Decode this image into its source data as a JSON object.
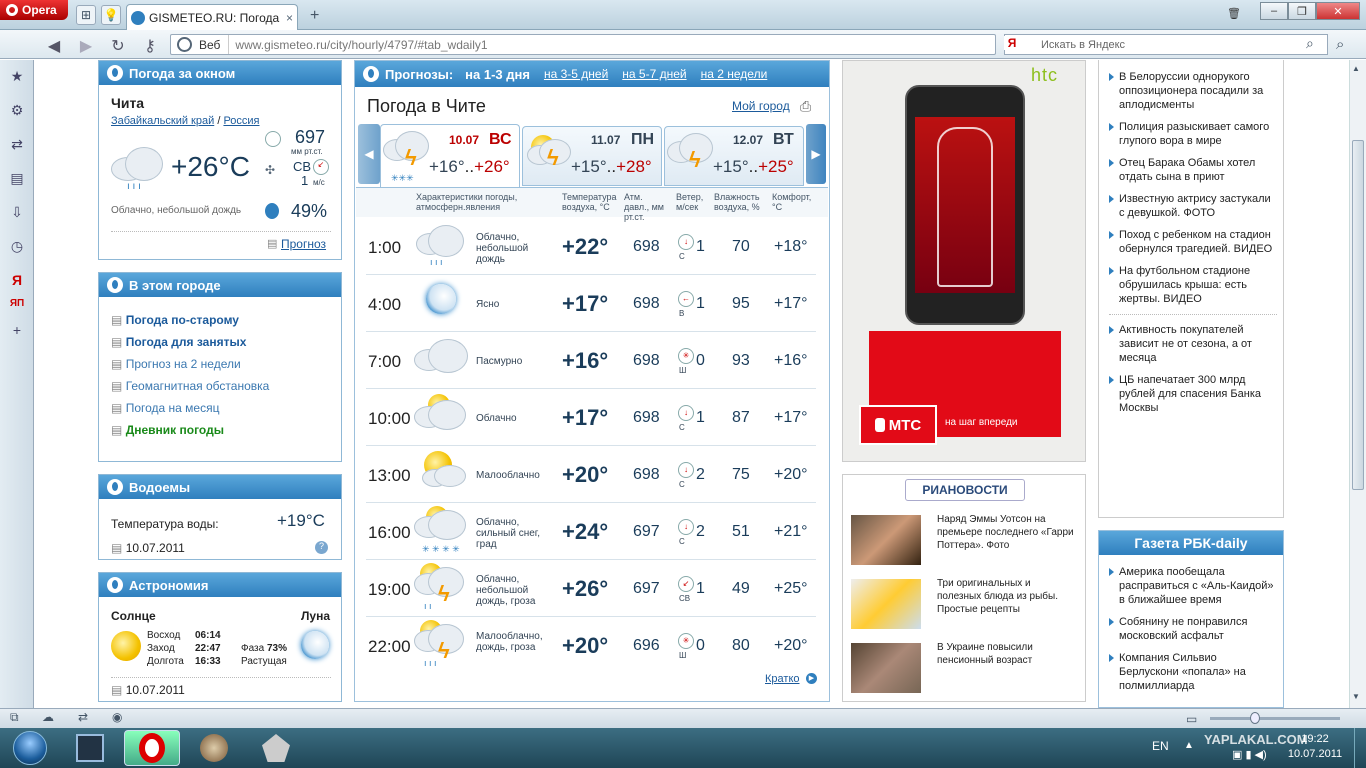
{
  "browser": {
    "app_name": "Opera",
    "tab_title": "GISMETEO.RU: Погода ...",
    "veb_label": "Веб",
    "url": "www.gismeteo.ru/city/hourly/4797/#tab_wdaily1",
    "search_placeholder": "Искать в Яндекс"
  },
  "left_widget": {
    "title": "Погода за окном",
    "city": "Чита",
    "region": "Забайкальский край",
    "sep": "/",
    "country": "Россия",
    "temp": "+26°C",
    "pressure": "697",
    "pressure_unit": "мм рт.ст.",
    "wind_dir": "СВ",
    "wind_speed": "1",
    "wind_unit": "м/с",
    "desc": "Облачно, небольшой дождь",
    "humidity": "49%",
    "forecast_link": "Прогноз"
  },
  "city_box": {
    "title": "В этом городе",
    "links": [
      "Погода по-старому",
      "Погода для занятых",
      "Прогноз на 2 недели",
      "Геомагнитная обстановка",
      "Погода на месяц",
      "Дневник погоды"
    ]
  },
  "water": {
    "title": "Водоемы",
    "label": "Температура воды:",
    "value": "+19°C",
    "date": "10.07.2011"
  },
  "astro": {
    "title": "Астрономия",
    "sun_label": "Солнце",
    "moon_label": "Луна",
    "sunrise_label": "Восход",
    "sunrise": "06:14",
    "sunset_label": "Заход",
    "sunset": "22:47",
    "length_label": "Долгота",
    "length": "16:33",
    "phase_label": "Фаза",
    "phase": "73%",
    "phase_state": "Растущая",
    "date": "10.07.2011"
  },
  "forecast": {
    "title": "Прогнозы:",
    "tabs": [
      "на 1-3 дня",
      "на 3-5 дней",
      "на 5-7 дней",
      "на 2 недели"
    ],
    "city_title": "Погода в Чите",
    "my_city": "Мой город",
    "days": [
      {
        "date": "10.07",
        "dow": "ВС",
        "lo": "+16°",
        "sep": "..",
        "hi": "+26°"
      },
      {
        "date": "11.07",
        "dow": "ПН",
        "lo": "+15°",
        "sep": "..",
        "hi": "+28°"
      },
      {
        "date": "12.07",
        "dow": "ВТ",
        "lo": "+15°",
        "sep": "..",
        "hi": "+25°"
      }
    ],
    "headers": {
      "chars": "Характеристики погоды, атмосферн.явления",
      "temp": "Температура воздуха, °C",
      "press": "Атм. давл., мм рт.ст.",
      "wind": "Ветер, м/сек",
      "hum": "Влажность воздуха, %",
      "comfort": "Комфорт, °C"
    },
    "rows": [
      {
        "time": "1:00",
        "desc": "Облачно, небольшой дождь",
        "temp": "+22°",
        "press": "698",
        "wind_dir": "С",
        "wind": "1",
        "hum": "70",
        "comfort": "+18°",
        "icon": "cloud-rain-icon"
      },
      {
        "time": "4:00",
        "desc": "Ясно",
        "temp": "+17°",
        "press": "698",
        "wind_dir": "В",
        "wind": "1",
        "hum": "95",
        "comfort": "+17°",
        "icon": "moon-icon"
      },
      {
        "time": "7:00",
        "desc": "Пасмурно",
        "temp": "+16°",
        "press": "698",
        "wind_dir": "Ш",
        "wind": "0",
        "hum": "93",
        "comfort": "+16°",
        "icon": "overcast-icon"
      },
      {
        "time": "10:00",
        "desc": "Облачно",
        "temp": "+17°",
        "press": "698",
        "wind_dir": "С",
        "wind": "1",
        "hum": "87",
        "comfort": "+17°",
        "icon": "cloudy-icon"
      },
      {
        "time": "13:00",
        "desc": "Малооблачно",
        "temp": "+20°",
        "press": "698",
        "wind_dir": "С",
        "wind": "2",
        "hum": "75",
        "comfort": "+20°",
        "icon": "partly-cloudy-icon"
      },
      {
        "time": "16:00",
        "desc": "Облачно, сильный снег, град",
        "temp": "+24°",
        "press": "697",
        "wind_dir": "С",
        "wind": "2",
        "hum": "51",
        "comfort": "+21°",
        "icon": "snow-hail-icon"
      },
      {
        "time": "19:00",
        "desc": "Облачно, небольшой дождь, гроза",
        "temp": "+26°",
        "press": "697",
        "wind_dir": "СВ",
        "wind": "1",
        "hum": "49",
        "comfort": "+25°",
        "icon": "thunderstorm-icon"
      },
      {
        "time": "22:00",
        "desc": "Малооблачно, дождь, гроза",
        "temp": "+20°",
        "press": "696",
        "wind_dir": "Ш",
        "wind": "0",
        "hum": "80",
        "comfort": "+20°",
        "icon": "thunderstorm-icon"
      }
    ],
    "short_link": "Кратко"
  },
  "ad": {
    "brand": "htc",
    "mts": "МТС",
    "slogan": "на шаг впереди"
  },
  "ria": {
    "logo": "РИАНОВОСТИ",
    "items": [
      "Наряд Эммы Уотсон на премьере последнего «Гарри Поттера». Фото",
      "Три оригинальных и полезных блюда из рыбы. Простые рецепты",
      "В Украине повысили пенсионный возраст"
    ]
  },
  "news": {
    "items": [
      "В Белоруссии однорукого оппозиционера посадили за аплодисменты",
      "Полиция разыскивает самого глупого вора в мире",
      "Отец Барака Обамы хотел отдать сына в приют",
      "Известную актрису застукали с девушкой. ФОТО",
      "Поход с ребенком на стадион обернулся трагедией. ВИДЕО",
      "На футбольном стадионе обрушилась крыша: есть жертвы. ВИДЕО",
      "Активность покупателей зависит не от сезона, а от месяца",
      "ЦБ напечатает 300 млрд рублей для спасения Банка Москвы"
    ]
  },
  "rbc": {
    "title": "Газета РБК-daily",
    "items": [
      "Америка пообещала расправиться с «Аль-Каидой» в ближайшее время",
      "Собянину не понравился московский асфальт",
      "Компания Сильвио Берлускони «попала» на полмиллиарда"
    ]
  },
  "taskbar": {
    "lang": "EN",
    "time": "19:22",
    "date": "10.07.2011",
    "watermark": "YAPLAKAL.COM"
  }
}
